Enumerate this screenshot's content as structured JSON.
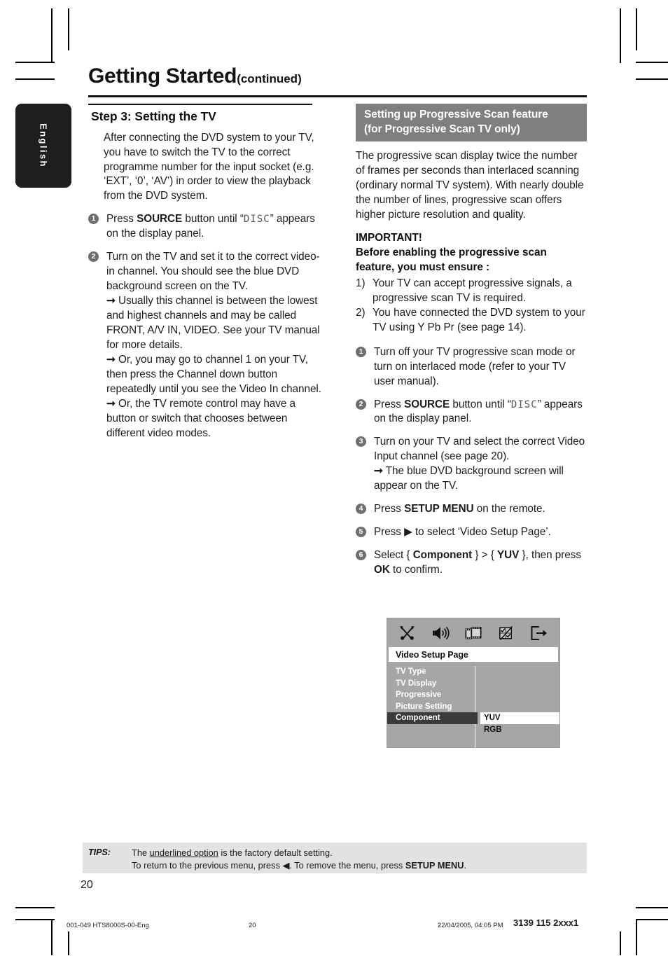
{
  "header": {
    "title": "Getting Started",
    "continued": "(continued)"
  },
  "language_tab": {
    "label": "English"
  },
  "left_column": {
    "heading": "Step 3:  Setting the TV",
    "intro": "After connecting the DVD system to your TV, you have to switch the TV to the correct programme number for the input socket (e.g. ‘EXT’, ‘0’, ‘AV’) in order to view the playback from the DVD system.",
    "steps": [
      {
        "number": "1",
        "text_before": "Press ",
        "bold": "SOURCE",
        "text_mid": " button until “",
        "lcd": "DISC",
        "text_after": "” appears on the display panel."
      },
      {
        "number": "2",
        "text": "Turn on the TV and set it to the correct video-in channel. You should see the blue DVD background screen on the TV.",
        "arrows": [
          "Usually this channel is between the lowest and highest channels and may be called FRONT, A/V IN, VIDEO. See your TV manual for more details.",
          "Or, you may go to channel 1 on your TV, then press the Channel down button repeatedly until you see the Video In channel.",
          "Or, the TV remote control may have a button or switch that chooses between different video modes."
        ]
      }
    ]
  },
  "right_column": {
    "banner_line1": "Setting up Progressive Scan feature",
    "banner_line2": "(for Progressive Scan TV only)",
    "intro": "The progressive scan display twice the number of frames per seconds than interlaced scanning (ordinary normal TV system). With nearly double the number of lines, progressive scan offers higher picture resolution and quality.",
    "important_title": "IMPORTANT!",
    "important_body": "Before enabling the progressive scan feature, you must ensure :",
    "conditions": [
      {
        "num": "1)",
        "text": "Your TV can accept progressive signals, a progressive scan TV is required."
      },
      {
        "num": "2)",
        "text": "You have connected the DVD system to your TV using Y Pb Pr (see page 14)."
      }
    ],
    "steps": [
      {
        "number": "1",
        "text": "Turn off your TV progressive scan mode or turn on interlaced mode (refer to your TV user manual)."
      },
      {
        "number": "2",
        "text_before": "Press ",
        "bold": "SOURCE",
        "text_mid": " button until “",
        "lcd": "DISC",
        "text_after": "” appears on the display panel."
      },
      {
        "number": "3",
        "text": "Turn on your TV and select the correct Video Input channel (see page 20).",
        "arrows": [
          "The blue DVD background screen will appear on the TV."
        ]
      },
      {
        "number": "4",
        "text_before": "Press ",
        "bold": "SETUP MENU",
        "text_after": " on the remote."
      },
      {
        "number": "5",
        "text_before": "Press ",
        "glyph": "▶",
        "text_after": " to select ‘Video Setup Page’."
      },
      {
        "number": "6",
        "text_before": "Select { ",
        "bold": "Component",
        "text_mid": " } > { ",
        "bold2": "YUV",
        "text_mid2": " }, then press ",
        "bold3": "OK",
        "text_after": " to confirm."
      }
    ]
  },
  "osd": {
    "icons": [
      {
        "name": "general-setup-icon",
        "label": "General Setup"
      },
      {
        "name": "audio-setup-icon",
        "label": "Audio Setup"
      },
      {
        "name": "video-setup-icon",
        "label": "Video Setup"
      },
      {
        "name": "preference-setup-icon",
        "label": "Preference Setup"
      },
      {
        "name": "exit-setup-icon",
        "label": "Exit Setup"
      }
    ],
    "title": "Video Setup Page",
    "menu_items": [
      {
        "label": "TV Type",
        "selected": false
      },
      {
        "label": "TV Display",
        "selected": false
      },
      {
        "label": "Progressive",
        "selected": false
      },
      {
        "label": "Picture Setting",
        "selected": false
      },
      {
        "label": "Component",
        "selected": true
      }
    ],
    "options": [
      {
        "label": "YUV",
        "highlighted": true
      },
      {
        "label": "RGB",
        "highlighted": false
      }
    ],
    "colors": {
      "background": "#a6a6a6",
      "selected_row": "#3c3a3a",
      "highlight": "#ffffff"
    }
  },
  "tips": {
    "label": "TIPS:",
    "line1_before": "The ",
    "line1_underlined": "underlined option",
    "line1_after": " is the factory default setting.",
    "line2_before": "To return to the previous menu, press ",
    "line2_glyph": "◀",
    "line2_mid": ". To remove the menu, press ",
    "line2_bold": "SETUP MENU",
    "line2_after": "."
  },
  "folio": {
    "page_number": "20"
  },
  "print_footer": {
    "file": "001-049 HTS8000S-00-Eng",
    "page": "20",
    "date": "22/04/2005, 04:05 PM",
    "code": "3139 115 2xxx1"
  }
}
